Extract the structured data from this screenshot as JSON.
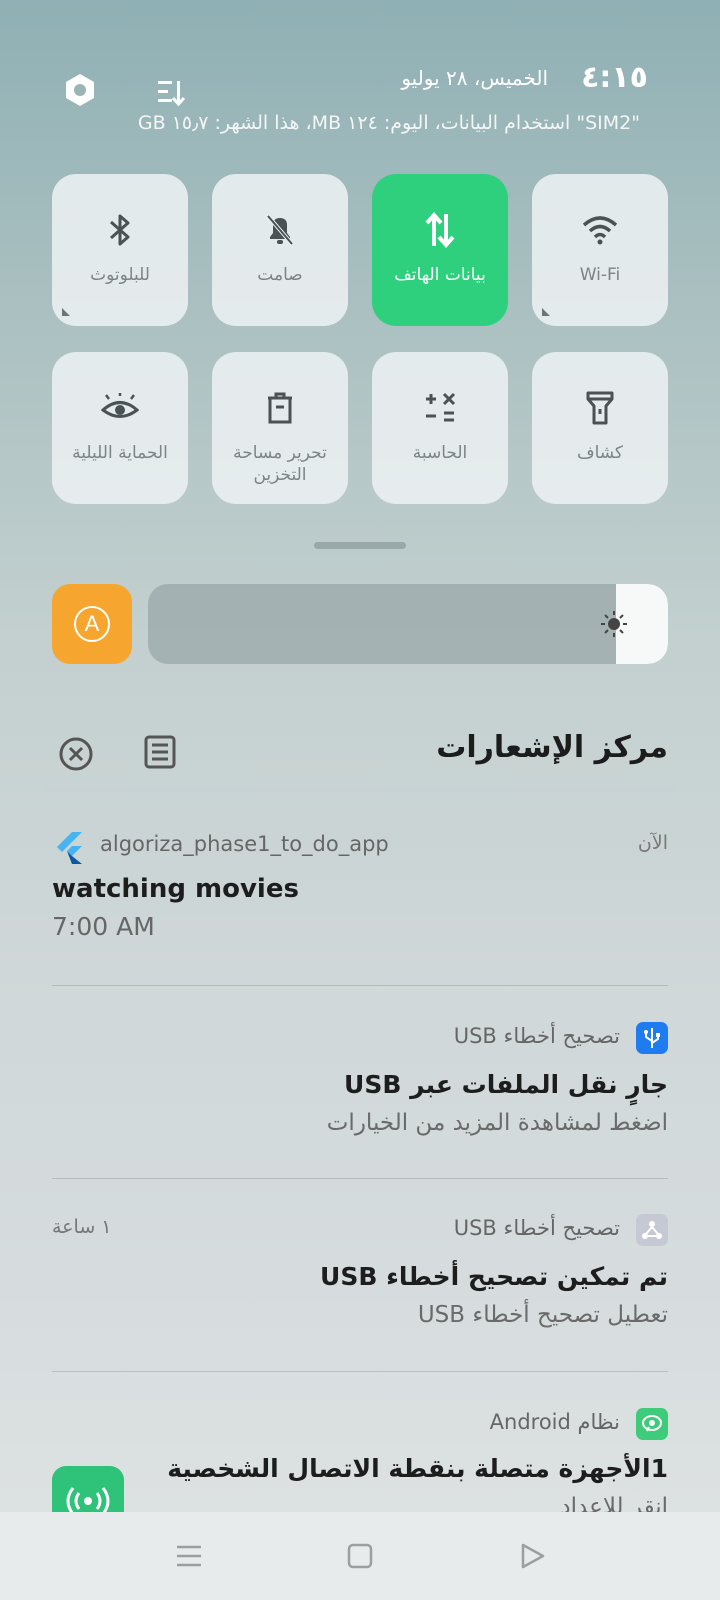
{
  "header": {
    "time": "٤:١٥",
    "date": "الخميس، ٢٨ يوليو",
    "data_usage": "\"SIM2\" استخدام البيانات، اليوم: ١٢٤ MB، هذا الشهر: ١٥٫٧ GB"
  },
  "tiles": [
    {
      "label": "Wi-Fi",
      "icon": "wifi-icon"
    },
    {
      "label": "بيانات الهاتف",
      "icon": "mobile-data-icon",
      "active": true
    },
    {
      "label": "صامت",
      "icon": "bell-off-icon"
    },
    {
      "label": "للبلوتوث",
      "icon": "bluetooth-icon"
    },
    {
      "label": "كشاف",
      "icon": "flashlight-icon"
    },
    {
      "label": "الحاسبة",
      "icon": "calculator-icon"
    },
    {
      "label": "تحرير مساحة التخزين",
      "icon": "trash-icon"
    },
    {
      "label": "الحماية الليلية",
      "icon": "eye-icon"
    }
  ],
  "brightness": {
    "auto_label": "A",
    "level": 0.1
  },
  "notification_center": {
    "title": "مركز الإشعارات"
  },
  "notifications": [
    {
      "app": "algoriza_phase1_to_do_app",
      "time": "الآن",
      "title": "watching movies",
      "body": "7:00 AM"
    },
    {
      "app": "تصحيح أخطاء USB",
      "title": "جارٍ نقل الملفات عبر USB",
      "body": "اضغط لمشاهدة المزيد من الخيارات"
    },
    {
      "app": "تصحيح أخطاء USB",
      "time": "١ ساعة",
      "title": "تم تمكين تصحيح أخطاء USB",
      "body": "تعطيل تصحيح أخطاء USB"
    },
    {
      "app": "نظام Android",
      "title": "1الأجهزة متصلة بنقطة الاتصال الشخصية",
      "body": "انقر للإعداد"
    }
  ],
  "colors": {
    "accent_green": "#2ed07e",
    "auto_orange": "#f6a62e",
    "usb_blue": "#1f7cf0"
  }
}
